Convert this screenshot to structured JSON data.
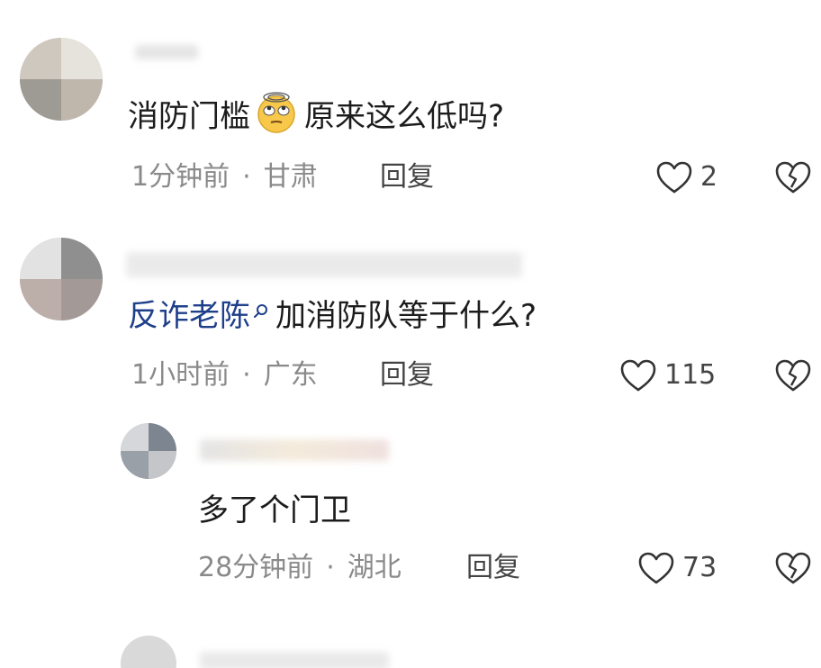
{
  "comments": [
    {
      "text": "消防门槛",
      "text_after": "原来这么低吗?",
      "emoji": "eye-roll-emoji",
      "time": "1分钟前",
      "location": "甘肃",
      "reply_label": "回复",
      "likes": "2"
    },
    {
      "mention": "反诈老陈",
      "text": "加消防队等于什么?",
      "time": "1小时前",
      "location": "广东",
      "reply_label": "回复",
      "likes": "115"
    },
    {
      "text": "多了个门卫",
      "time": "28分钟前",
      "location": "湖北",
      "reply_label": "回复",
      "likes": "73"
    }
  ],
  "separator": "·",
  "icons": {
    "like": "heart-outline-icon",
    "dislike": "broken-heart-icon",
    "mention": "search-icon"
  },
  "colors": {
    "text": "#1c1c1c",
    "meta": "#8a8a8a",
    "mention": "#1e3f8a"
  }
}
